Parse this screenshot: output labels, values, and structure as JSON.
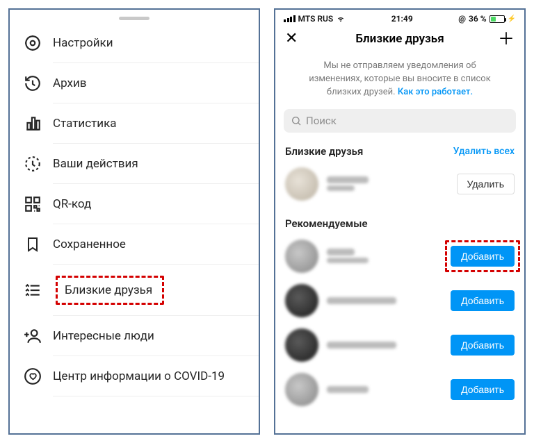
{
  "left": {
    "menu": [
      {
        "label": "Настройки",
        "name": "settings",
        "icon": "gear"
      },
      {
        "label": "Архив",
        "name": "archive",
        "icon": "history"
      },
      {
        "label": "Статистика",
        "name": "insights",
        "icon": "bars"
      },
      {
        "label": "Ваши действия",
        "name": "activity",
        "icon": "clock-dashed"
      },
      {
        "label": "QR-код",
        "name": "qr-code",
        "icon": "qr"
      },
      {
        "label": "Сохраненное",
        "name": "saved",
        "icon": "bookmark"
      },
      {
        "label": "Близкие друзья",
        "name": "close-friends",
        "icon": "list-star",
        "highlight": true
      },
      {
        "label": "Интересные люди",
        "name": "discover-people",
        "icon": "person-plus"
      },
      {
        "label": "Центр информации о COVID-19",
        "name": "covid-info",
        "icon": "heart-ring"
      }
    ]
  },
  "right": {
    "status": {
      "carrier": "MTS RUS",
      "time": "21:49",
      "activity": "@",
      "battery_pct": "36 %"
    },
    "header_title": "Близкие друзья",
    "info_line1": "Мы не отправляем уведомления об",
    "info_line2": "изменениях, которые вы вносите в список",
    "info_line3": "близких друзей. ",
    "info_link": "Как это работает.",
    "search_placeholder": "Поиск",
    "friends_header": "Близкие друзья",
    "clear_all": "Удалить всех",
    "remove_label": "Удалить",
    "recommended_header": "Рекомендуемые",
    "add_label": "Добавить"
  }
}
